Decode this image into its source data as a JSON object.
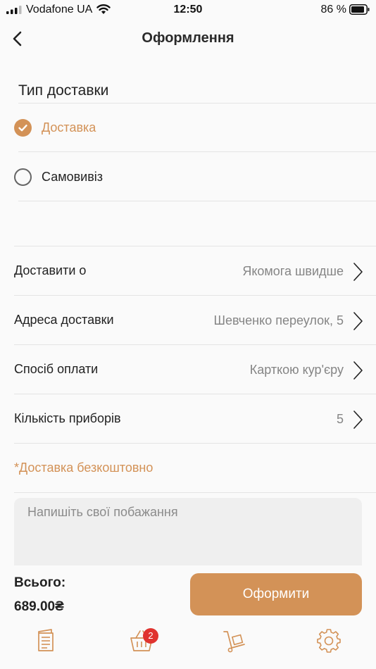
{
  "status_bar": {
    "carrier": "Vodafone UA",
    "time": "12:50",
    "battery_percent": "86 %",
    "signal_icon": "signal-icon",
    "wifi_icon": "wifi-icon",
    "battery_icon": "battery-icon"
  },
  "header": {
    "title": "Оформлення",
    "back_icon": "chevron-left-icon"
  },
  "delivery_type": {
    "title": "Тип доставки",
    "options": [
      {
        "label": "Доставка",
        "selected": true
      },
      {
        "label": "Самовивіз",
        "selected": false
      }
    ]
  },
  "settings": [
    {
      "label": "Доставити о",
      "value": "Якомога швидше"
    },
    {
      "label": "Адреса доставки",
      "value": "Шевченко переулок, 5"
    },
    {
      "label": "Спосіб оплати",
      "value": "Карткою кур'єру"
    },
    {
      "label": "Кількість приборів",
      "value": "5"
    }
  ],
  "free_delivery_note": "*Доставка безкоштовно",
  "wishes": {
    "placeholder": "Напишіть свої побажання",
    "value": ""
  },
  "summary": {
    "total_label": "Всього:",
    "total_value": "689.00₴",
    "checkout_label": "Оформити"
  },
  "tab_bar": {
    "items": [
      {
        "icon": "menu-icon"
      },
      {
        "icon": "basket-icon",
        "badge": "2"
      },
      {
        "icon": "delivery-cart-icon"
      },
      {
        "icon": "settings-gear-icon"
      }
    ]
  },
  "colors": {
    "accent": "#d39257",
    "badge": "#e0332f",
    "muted_text": "#858585",
    "background": "#fafafa"
  }
}
